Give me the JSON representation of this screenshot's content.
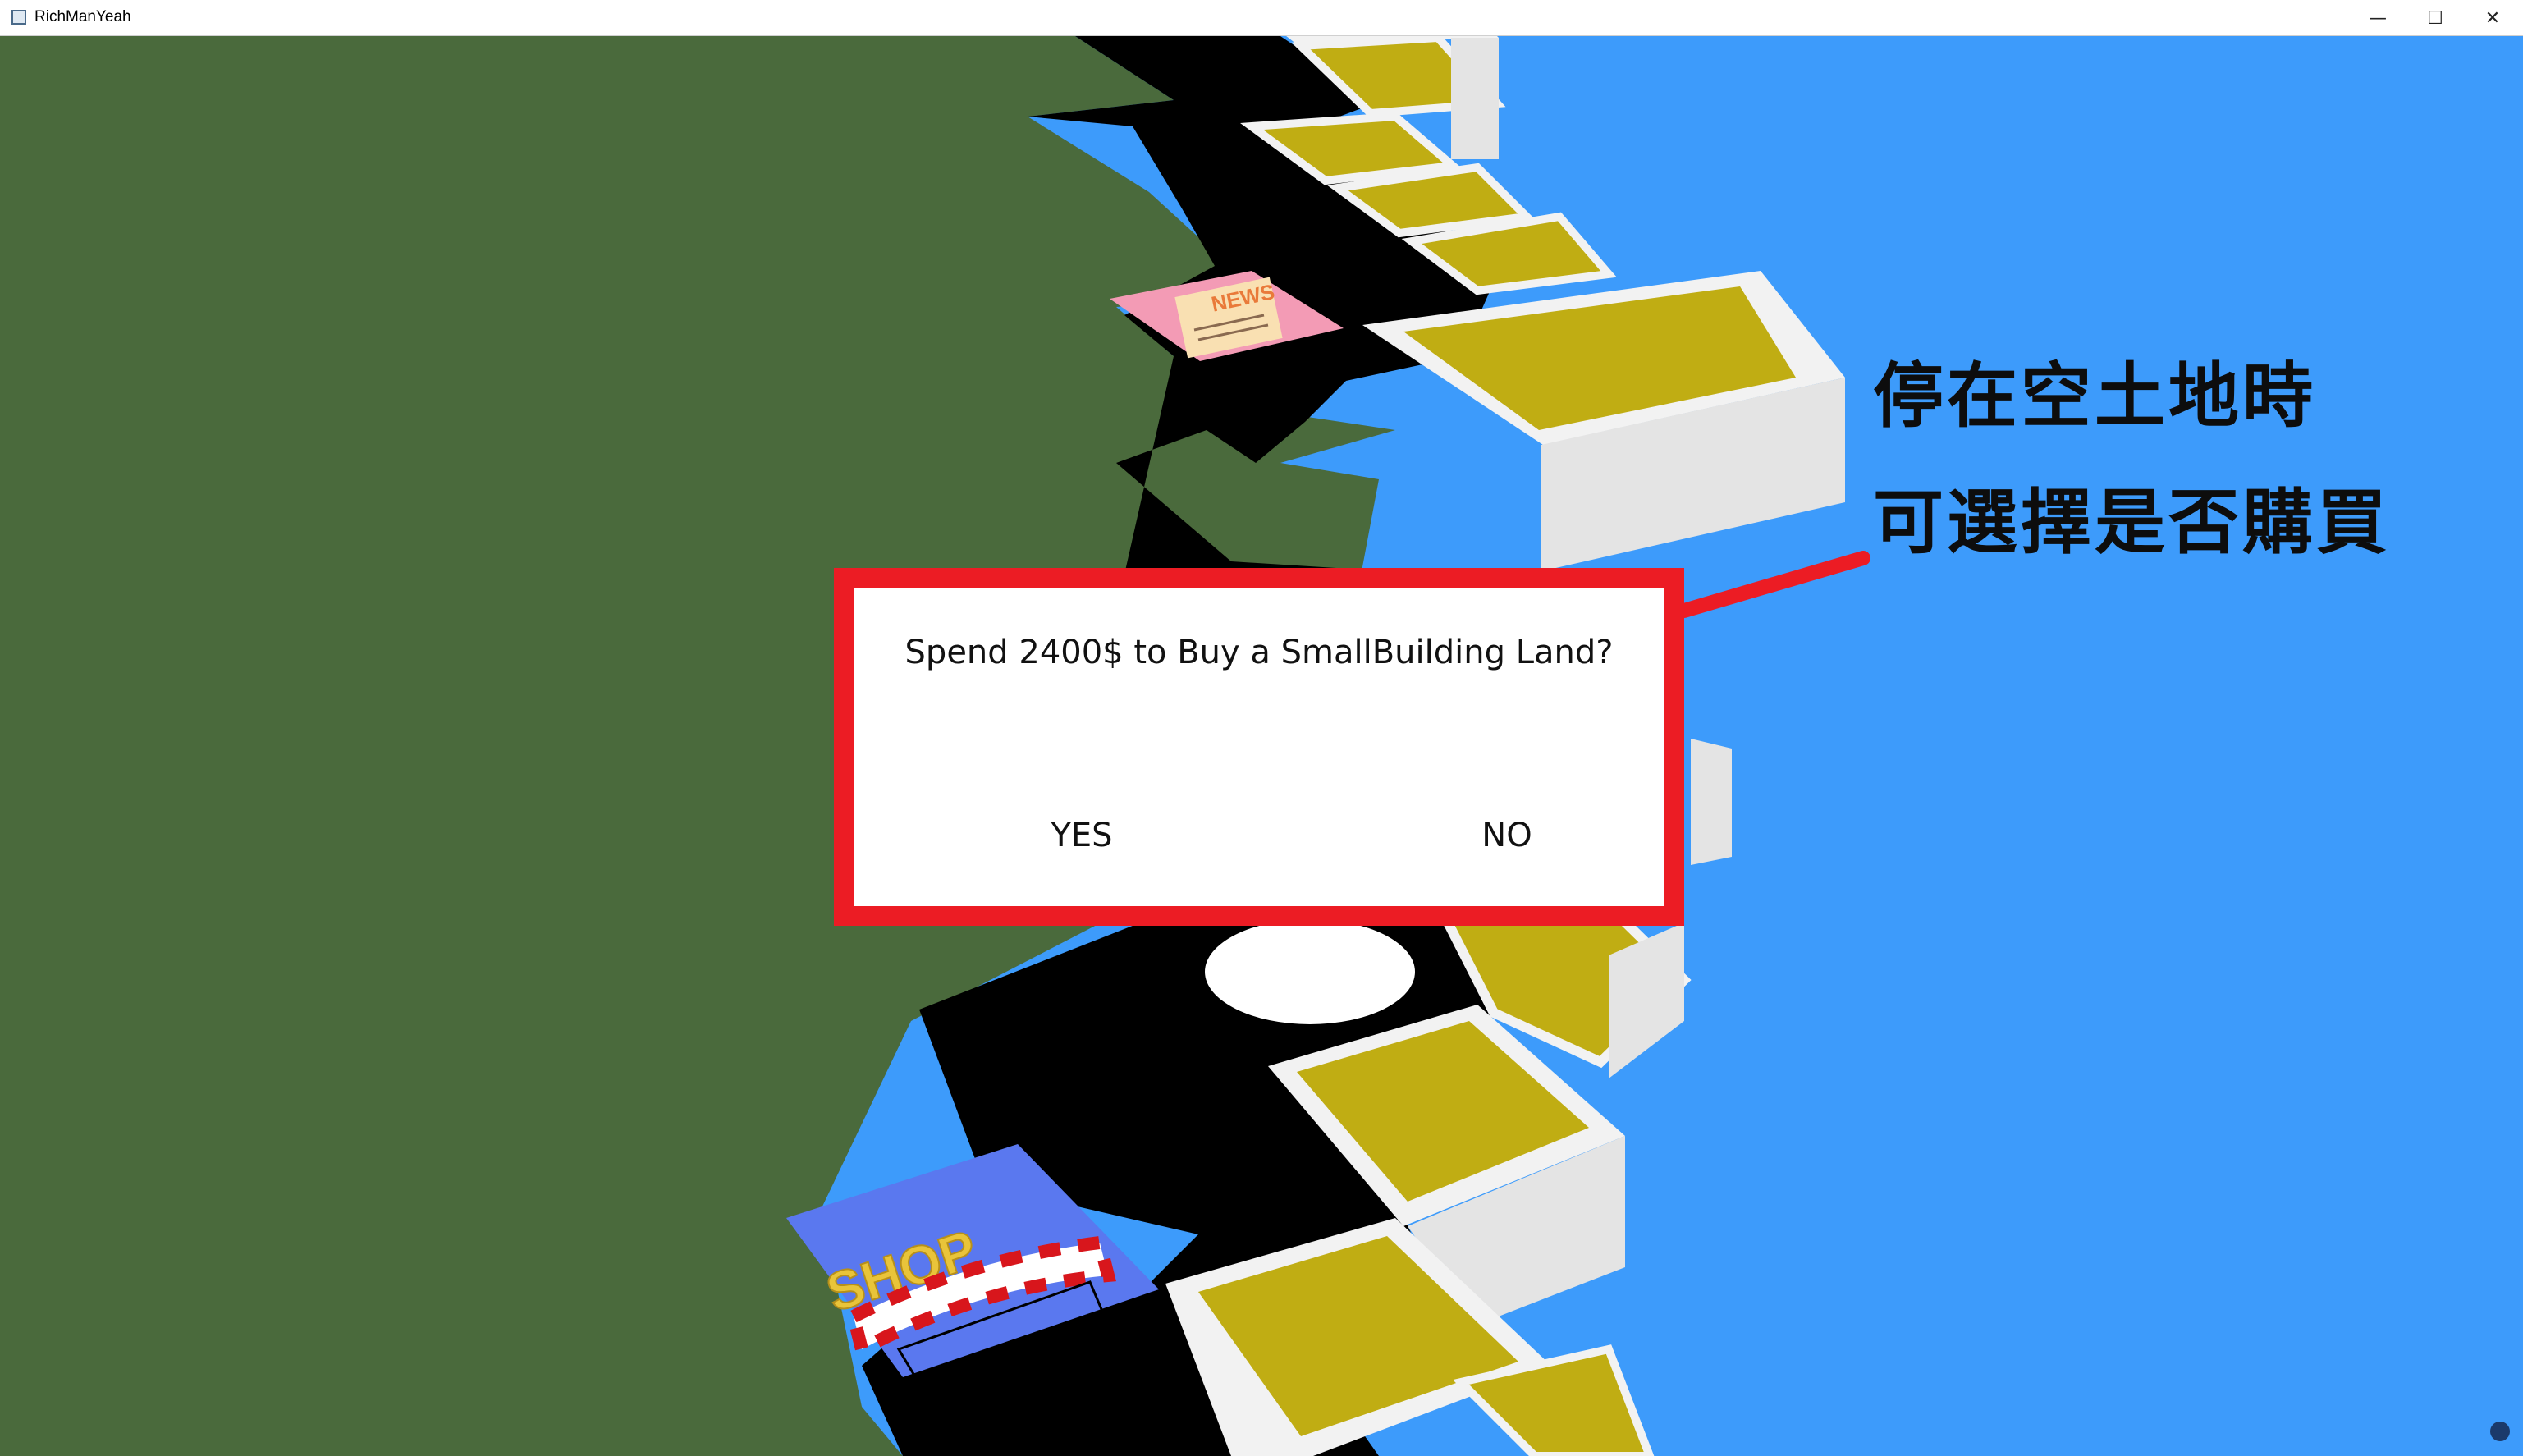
{
  "window": {
    "title": "RichManYeah",
    "controls": {
      "minimize": "—",
      "maximize": "☐",
      "close": "✕"
    }
  },
  "dialog": {
    "message": "Spend 2400$ to Buy a SmallBuilding Land?",
    "yes_label": "YES",
    "no_label": "NO"
  },
  "annotation": {
    "line1": "停在空土地時",
    "line2": "可選擇是否購買",
    "color": "#ec1c24"
  },
  "board": {
    "tiles": [
      {
        "kind": "news",
        "label": "NEWS"
      },
      {
        "kind": "shop",
        "label": "SHOP"
      }
    ]
  },
  "colors": {
    "grass": "#4a6a3c",
    "sky": "#3d9bfb",
    "road": "#000000",
    "land": "#c0ad13",
    "wall": "#f2f2f2",
    "highlight": "#ec1c24"
  }
}
